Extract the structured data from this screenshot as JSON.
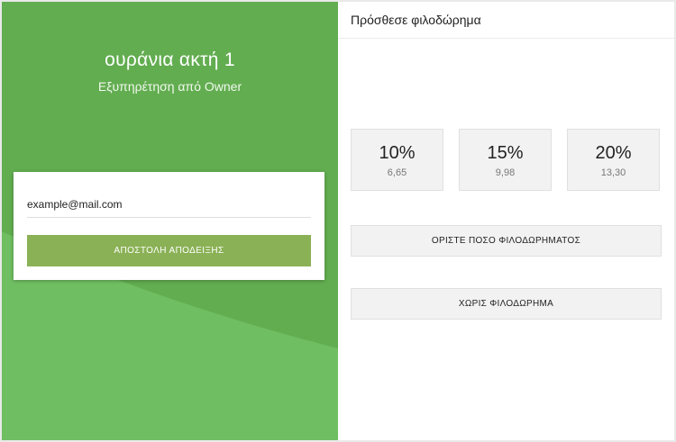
{
  "venue": {
    "name": "ουράνια ακτή 1",
    "subtitle": "Εξυπηρέτηση από Owner"
  },
  "receipt": {
    "email_value": "example@mail.com",
    "send_label": "ΑΠΟΣΤΟΛΗ ΑΠΟΔΕΙΞΗΣ"
  },
  "tip": {
    "title": "Πρόσθεσε φιλοδώρημα",
    "options": [
      {
        "percent": "10%",
        "amount": "6,65"
      },
      {
        "percent": "15%",
        "amount": "9,98"
      },
      {
        "percent": "20%",
        "amount": "13,30"
      }
    ],
    "custom_label": "ΟΡΙΣΤΕ ΠΟΣΟ ΦΙΛΟΔΩΡΗΜΑΤΟΣ",
    "none_label": "ΧΩΡΙΣ ΦΙΛΟΔΩΡΗΜΑ"
  },
  "colors": {
    "panel_green": "#62ad50",
    "wave_green": "#6fbe62",
    "button_green": "#8ab155"
  }
}
